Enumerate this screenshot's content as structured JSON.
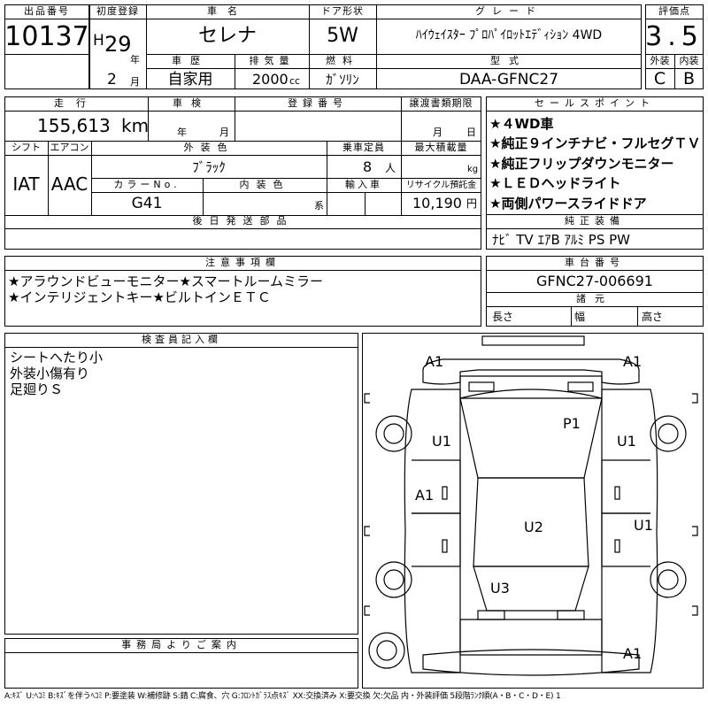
{
  "header": {
    "lot_no_label": "出品番号",
    "lot_no": "10137",
    "first_reg_label": "初度登録",
    "era": "H",
    "year": "29",
    "year_unit": "年",
    "month": "2",
    "month_unit": "月",
    "car_name_label": "車名",
    "car_name": "セレナ",
    "door_label": "ドア形状",
    "door": "5W",
    "grade_label": "グレード",
    "grade": "ﾊｲｳｪｲｽﾀｰ ﾌﾟﾛﾊﾟｲﾛｯﾄｴﾃﾞｨｼｮﾝ 4WD",
    "score_label": "評価点",
    "score": "3.5",
    "history_label": "車歴",
    "history": "自家用",
    "displacement_label": "排気量",
    "displacement": "2000",
    "displacement_unit": "cc",
    "fuel_label": "燃料",
    "fuel": "ｶﾞｿﾘﾝ",
    "model_label": "型式",
    "model": "DAA-GFNC27",
    "exterior_label": "外装",
    "exterior": "C",
    "interior_label": "内装",
    "interior": "B"
  },
  "details": {
    "mileage_label": "走行",
    "mileage": "155,613",
    "mileage_unit": "km",
    "inspection_label": "車検",
    "inspection_year_unit": "年",
    "inspection_month_unit": "月",
    "reg_no_label": "登録番号",
    "transfer_label": "譲渡書類期限",
    "transfer_month_unit": "月",
    "transfer_day_unit": "日",
    "shift_label": "シフト",
    "shift": "IAT",
    "ac_label": "エアコン",
    "ac": "AAC",
    "color_label": "外装色",
    "color": "ﾌﾞﾗｯｸ",
    "capacity_label": "乗車定員",
    "capacity": "8",
    "capacity_unit": "人",
    "load_label": "最大積載量",
    "load_unit": "kg",
    "color_no_label": "カラーNo.",
    "color_no": "G41",
    "interior_color_label": "内装色",
    "interior_color_unit": "系",
    "import_label": "輸入車",
    "recycle_label": "リサイクル預託金",
    "recycle": "10,190",
    "recycle_unit": "円",
    "later_parts_label": "後日発送部品"
  },
  "sales_points": {
    "label": "セールスポイント",
    "items": [
      "★４WD車",
      "★純正９インチナビ・フルセグＴＶ",
      "★純正フリップダウンモニター",
      "★ＬＥＤヘッドライト",
      "★両側パワースライドドア"
    ]
  },
  "equipment": {
    "label": "純正装備",
    "value": "ﾅﾋﾞ TV ｴｱB ｱﾙﾐ PS PW"
  },
  "notes": {
    "label": "注意事項欄",
    "lines": [
      "★アラウンドビューモニター★スマートルームミラー",
      "★インテリジェントキー★ビルトインＥＴＣ"
    ]
  },
  "chassis": {
    "label": "車台番号",
    "value": "GFNC27-006691",
    "specs_label": "諸元",
    "length_label": "長さ",
    "width_label": "幅",
    "height_label": "高さ"
  },
  "inspector": {
    "label": "検査員記入欄",
    "lines": [
      "シートへたり小",
      "外装小傷有り",
      "足廻りＳ"
    ]
  },
  "office": {
    "label": "事務局よりご案内"
  },
  "diagram": {
    "marks": {
      "front_left": "A1",
      "front_right": "A1",
      "fender_left": "U1",
      "fender_right": "U1",
      "hood": "P1",
      "door_left": "A1",
      "door_right": "U1",
      "roof": "U2",
      "rear": "U3",
      "rear_bumper": "A1"
    }
  },
  "legend": "A:ｷｽﾞ U:ﾍｺﾐ B:ｷｽﾞを伴うﾍｺﾐ P:要塗装 W:補修跡 S:錆 C:腐食、穴 G:ﾌﾛﾝﾄｶﾞﾗｽ点ｷｽﾞ XX:交換済み X:要交換 欠:欠品 内・外装評価 5段階ﾗﾝｸ順(A・B・C・D・E) 1"
}
